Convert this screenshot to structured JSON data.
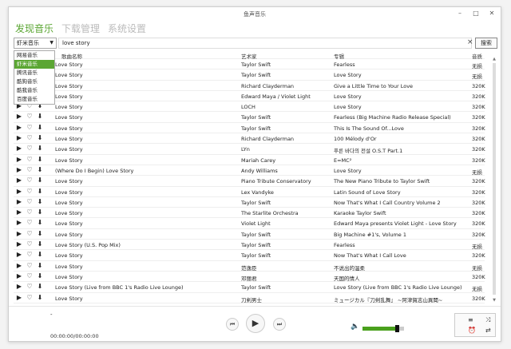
{
  "window": {
    "title": "鱼声音乐",
    "minimize": "–",
    "maximize": "□",
    "close": "✕"
  },
  "nav": {
    "tabs": [
      {
        "label": "发现音乐",
        "active": true
      },
      {
        "label": "下载管理"
      },
      {
        "label": "系统设置"
      }
    ]
  },
  "search": {
    "source": "虾米音乐",
    "query": "love story",
    "button": "搜索",
    "clear": "×"
  },
  "dropdown": {
    "options": [
      "网易音乐",
      "虾米音乐",
      "腾讯音乐",
      "酷狗音乐",
      "酷我音乐",
      "百度音乐"
    ],
    "selected_index": 1
  },
  "table": {
    "headers": {
      "title": "歌曲名称",
      "artist": "艺术家",
      "album": "专辑",
      "quality": "音质"
    },
    "rows": [
      {
        "title": "Love Story",
        "artist": "Taylor Swift",
        "album": "Fearless",
        "quality": "无损"
      },
      {
        "title": "Love Story",
        "artist": "Taylor Swift",
        "album": "Love Story",
        "quality": "无损"
      },
      {
        "title": "Love Story",
        "artist": "Richard Clayderman",
        "album": "Give a Little Time to Your Love",
        "quality": "320K"
      },
      {
        "title": "Love Story",
        "artist": "Edward Maya / Violet Light",
        "album": "Love Story",
        "quality": "320K"
      },
      {
        "title": "Love Story",
        "artist": "LOCH",
        "album": "Love Story",
        "quality": "320K"
      },
      {
        "title": "Love Story",
        "artist": "Taylor Swift",
        "album": "Fearless (Big Machine Radio Release Special)",
        "quality": "320K"
      },
      {
        "title": "Love Story",
        "artist": "Taylor Swift",
        "album": "This Is The Sound Of...Love",
        "quality": "320K"
      },
      {
        "title": "Love Story",
        "artist": "Richard Clayderman",
        "album": "100 Mélody d'Or",
        "quality": "320K"
      },
      {
        "title": "Love Story",
        "artist": "LYn",
        "album": "푸른 바다의 전설 O.S.T Part.1",
        "quality": "320K"
      },
      {
        "title": "Love Story",
        "artist": "Mariah Carey",
        "album": "E=MC²",
        "quality": "320K"
      },
      {
        "title": "(Where Do I Begin) Love Story",
        "artist": "Andy Williams",
        "album": "Love Story",
        "quality": "无损"
      },
      {
        "title": "Love Story",
        "artist": "Piano Tribute Conservatory",
        "album": "The New Piano Tribute to Taylor Swift",
        "quality": "320K"
      },
      {
        "title": "Love Story",
        "artist": "Lex Vandyke",
        "album": "Latin Sound of Love Story",
        "quality": "320K"
      },
      {
        "title": "Love Story",
        "artist": "Taylor Swift",
        "album": "Now That's What I Call Country Volume 2",
        "quality": "320K"
      },
      {
        "title": "Love Story",
        "artist": "The Starlite Orchestra",
        "album": "Karaoke Taylor Swift",
        "quality": "320K"
      },
      {
        "title": "Love Story",
        "artist": "Violet Light",
        "album": "Edward Maya presents Violet Light - Love Story",
        "quality": "320K"
      },
      {
        "title": "Love Story",
        "artist": "Taylor Swift",
        "album": "Big Machine #1's, Volume 1",
        "quality": "320K"
      },
      {
        "title": "Love Story (U.S. Pop Mix)",
        "artist": "Taylor Swift",
        "album": "Fearless",
        "quality": "无损"
      },
      {
        "title": "Love Story",
        "artist": "Taylor Swift",
        "album": "Now That's What I Call Love",
        "quality": "320K"
      },
      {
        "title": "Love Story",
        "artist": "范逸臣",
        "album": "不说出的温柔",
        "quality": "无损"
      },
      {
        "title": "Love Story",
        "artist": "邓丽君",
        "album": "天国的情人",
        "quality": "320K"
      },
      {
        "title": "Love Story (Live from BBC 1's Radio Live Lounge)",
        "artist": "Taylor Swift",
        "album": "Love Story (Live from BBC 1's Radio Live Lounge)",
        "quality": "无损"
      },
      {
        "title": "Love Story",
        "artist": "刀剣男士",
        "album": "ミュージカル『刀剣乱舞』 ~阿津賀志山異聞~",
        "quality": "320K"
      }
    ]
  },
  "player": {
    "now_playing": "-",
    "time": "00:00:00/00:00:00",
    "volume": 0.82
  },
  "colors": {
    "accent": "#5ba633",
    "volume": "#4aa01d"
  },
  "icons": {
    "play": "▶",
    "heart": "♡",
    "download": "⬇",
    "prev": "⏮",
    "play_big": "▶",
    "next": "⏭",
    "speaker": "🔈",
    "repeat": "⇄",
    "shuffle": "⤨",
    "list": "≡",
    "timer": "⏰"
  }
}
